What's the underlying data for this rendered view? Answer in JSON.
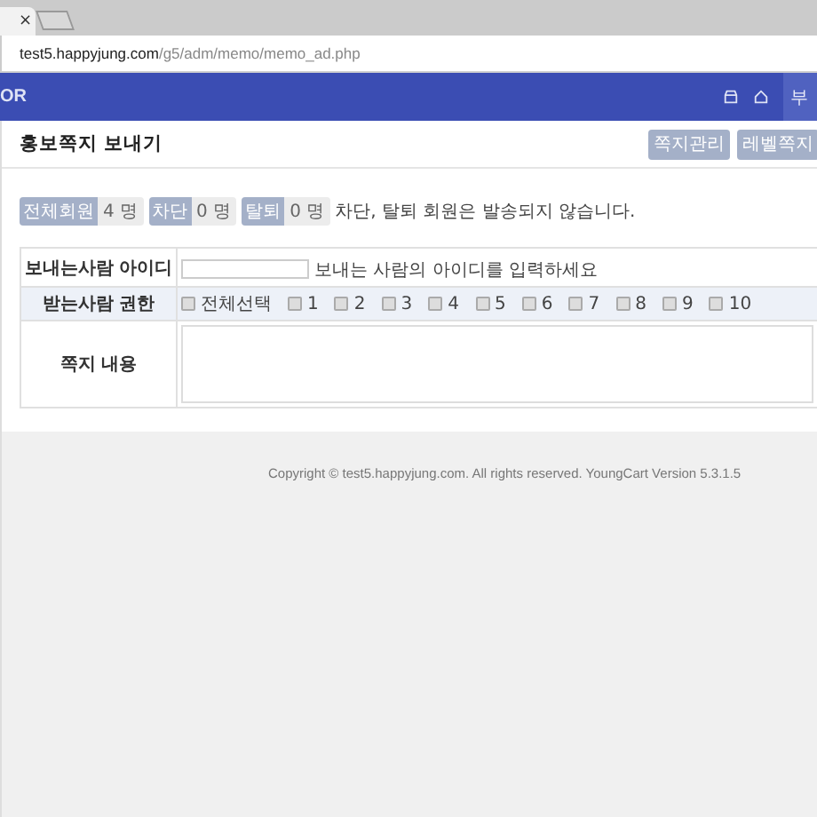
{
  "browser": {
    "tabs": [
      {
        "close": "×",
        "selected": true
      }
    ],
    "url_host": "test5.happyjung.com",
    "url_path": "/g5/adm/memo/memo_ad.php"
  },
  "header": {
    "logo": "OR",
    "menu_button": "부"
  },
  "page": {
    "title": "홍보쪽지 보내기",
    "buttons": [
      "쪽지관리",
      "레벨쪽지"
    ]
  },
  "stats": [
    {
      "label": "전체회원",
      "count": "4 명"
    },
    {
      "label": "차단",
      "count": "0 명"
    },
    {
      "label": "탈퇴",
      "count": "0 명"
    }
  ],
  "stats_note": "차단, 탈퇴 회원은 발송되지 않습니다.",
  "form": {
    "sender_label": "보내는사람 아이디",
    "sender_hint": "보내는 사람의 아이디를 입력하세요",
    "level_label": "받는사람 권한",
    "levels": [
      {
        "label": "전체선택",
        "checked": false
      },
      {
        "label": "1",
        "checked": false
      },
      {
        "label": "2",
        "checked": false
      },
      {
        "label": "3",
        "checked": false
      },
      {
        "label": "4",
        "checked": false
      },
      {
        "label": "5",
        "checked": false
      },
      {
        "label": "6",
        "checked": false
      },
      {
        "label": "7",
        "checked": false
      },
      {
        "label": "8",
        "checked": false
      },
      {
        "label": "9",
        "checked": false
      },
      {
        "label": "10",
        "checked": false
      }
    ],
    "content_label": "쪽지 내용"
  },
  "footer": "Copyright © test5.happyjung.com. All rights reserved. YoungCart Version 5.3.1.5"
}
